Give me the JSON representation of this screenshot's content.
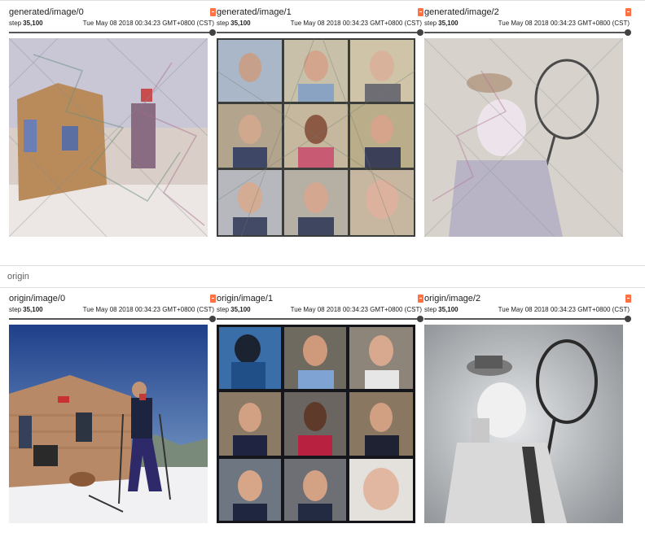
{
  "sections": [
    {
      "name": "generated",
      "cards": [
        {
          "title": "generated/image/0",
          "step_label": "step",
          "step_value": "35,100",
          "timestamp": "Tue May 08 2018 00:34:23 GMT+0800 (CST)",
          "image": "stylized-mosaic-skier-cabin"
        },
        {
          "title": "generated/image/1",
          "step_label": "step",
          "step_value": "35,100",
          "timestamp": "Tue May 08 2018 00:34:23 GMT+0800 (CST)",
          "image": "stylized-mosaic-portrait-grid"
        },
        {
          "title": "generated/image/2",
          "step_label": "step",
          "step_value": "35,100",
          "timestamp": "Tue May 08 2018 00:34:23 GMT+0800 (CST)",
          "image": "stylized-mosaic-clown-tennis"
        }
      ]
    },
    {
      "name": "origin",
      "cards": [
        {
          "title": "origin/image/0",
          "step_label": "step",
          "step_value": "35,100",
          "timestamp": "Tue May 08 2018 00:34:23 GMT+0800 (CST)",
          "image": "photo-skier-cabin"
        },
        {
          "title": "origin/image/1",
          "step_label": "step",
          "step_value": "35,100",
          "timestamp": "Tue May 08 2018 00:34:23 GMT+0800 (CST)",
          "image": "photo-portrait-grid"
        },
        {
          "title": "origin/image/2",
          "step_label": "step",
          "step_value": "35,100",
          "timestamp": "Tue May 08 2018 00:34:23 GMT+0800 (CST)",
          "image": "photo-clown-tennis"
        }
      ]
    }
  ],
  "colors": {
    "pin": "#ff7043",
    "slider": "#555555",
    "accent": "#ff7043"
  }
}
